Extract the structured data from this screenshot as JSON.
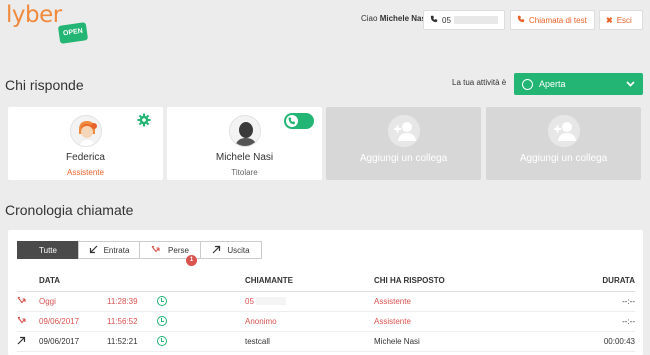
{
  "header": {
    "logo_text": "lyber",
    "logo_badge": "OPEN",
    "greeting_prefix": "Ciao",
    "user_name": "Michele Nasi!",
    "phone_prefix": "05",
    "test_call_label": "Chiamata di test",
    "exit_label": "Esci"
  },
  "responders": {
    "title": "Chi risponde",
    "activity_label": "La tua attività è",
    "activity_value": "Aperta",
    "cards": [
      {
        "name": "Federica",
        "role": "Assistente"
      },
      {
        "name": "Michele Nasi",
        "role": "Titolare"
      },
      {
        "add_label": "Aggiungi un collega"
      },
      {
        "add_label": "Aggiungi un collega"
      }
    ]
  },
  "history": {
    "title": "Cronologia chiamate",
    "tabs": [
      {
        "label": "Tutte",
        "icon": ""
      },
      {
        "label": "Entrata",
        "icon": "arrow-in-icon"
      },
      {
        "label": "Perse",
        "icon": "missed-icon",
        "badge": "1"
      },
      {
        "label": "Uscita",
        "icon": "arrow-out-icon"
      }
    ],
    "columns": [
      "DATA",
      "CHIAMANTE",
      "CHI HA RISPOSTO",
      "DURATA"
    ],
    "rows": [
      {
        "date": "Oggi",
        "time": "11:28:39",
        "caller": "05",
        "answered_by": "Assistente",
        "duration": "--:--",
        "type": "missed"
      },
      {
        "date": "09/06/2017",
        "time": "11:56:52",
        "caller": "Anonimo",
        "answered_by": "Assistente",
        "duration": "--:--",
        "type": "missed"
      },
      {
        "date": "09/06/2017",
        "time": "11:52:21",
        "caller": "testcall",
        "answered_by": "Michele Nasi",
        "duration": "00:00:43",
        "type": "outgoing"
      }
    ]
  },
  "colors": {
    "orange": "#e8632a",
    "green": "#22b573",
    "red": "#d9534f"
  }
}
